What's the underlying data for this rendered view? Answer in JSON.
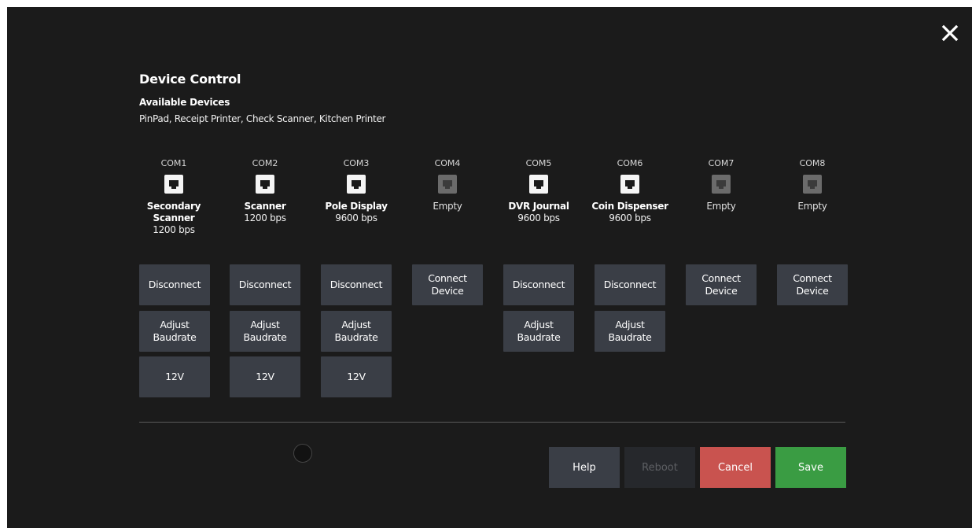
{
  "dialog": {
    "title": "Device Control",
    "subtitle": "Available Devices",
    "available_devices": "PinPad, Receipt Printer, Check Scanner, Kitchen Printer"
  },
  "icons": {
    "close": "close-icon",
    "port": "ethernet-port-icon"
  },
  "ports": [
    {
      "label": "COM1",
      "device_line1": "Secondary",
      "device_line2": "Scanner",
      "baud": "1200 bps",
      "active": true,
      "connect_label": "Disconnect",
      "adjust_label_line1": "Adjust",
      "adjust_label_line2": "Baudrate",
      "power_label": "12V"
    },
    {
      "label": "COM2",
      "device_line1": "Scanner",
      "device_line2": "",
      "baud": "1200 bps",
      "active": true,
      "connect_label": "Disconnect",
      "adjust_label_line1": "Adjust",
      "adjust_label_line2": "Baudrate",
      "power_label": "12V"
    },
    {
      "label": "COM3",
      "device_line1": "Pole Display",
      "device_line2": "",
      "baud": "9600 bps",
      "active": true,
      "connect_label": "Disconnect",
      "adjust_label_line1": "Adjust",
      "adjust_label_line2": "Baudrate",
      "power_label": "12V"
    },
    {
      "label": "COM4",
      "device_line1": "Empty",
      "device_line2": "",
      "baud": "",
      "active": false,
      "connect_label_line1": "Connect",
      "connect_label_line2": "Device"
    },
    {
      "label": "COM5",
      "device_line1": "DVR Journal",
      "device_line2": "",
      "baud": "9600 bps",
      "active": true,
      "connect_label": "Disconnect",
      "adjust_label_line1": "Adjust",
      "adjust_label_line2": "Baudrate"
    },
    {
      "label": "COM6",
      "device_line1": "Coin Dispenser",
      "device_line2": "",
      "baud": "9600 bps",
      "active": true,
      "connect_label": "Disconnect",
      "adjust_label_line1": "Adjust",
      "adjust_label_line2": "Baudrate"
    },
    {
      "label": "COM7",
      "device_line1": "Empty",
      "device_line2": "",
      "baud": "",
      "active": false,
      "connect_label_line1": "Connect",
      "connect_label_line2": "Device"
    },
    {
      "label": "COM8",
      "device_line1": "Empty",
      "device_line2": "",
      "baud": "",
      "active": false,
      "connect_label_line1": "Connect",
      "connect_label_line2": "Device"
    }
  ],
  "footer": {
    "help_label": "Help",
    "reboot_label": "Reboot",
    "cancel_label": "Cancel",
    "save_label": "Save"
  },
  "colors": {
    "background": "#1b1b1b",
    "button": "#3a3e46",
    "cancel": "#c9534f",
    "save": "#3a9c43",
    "disabled": "#26282c"
  }
}
